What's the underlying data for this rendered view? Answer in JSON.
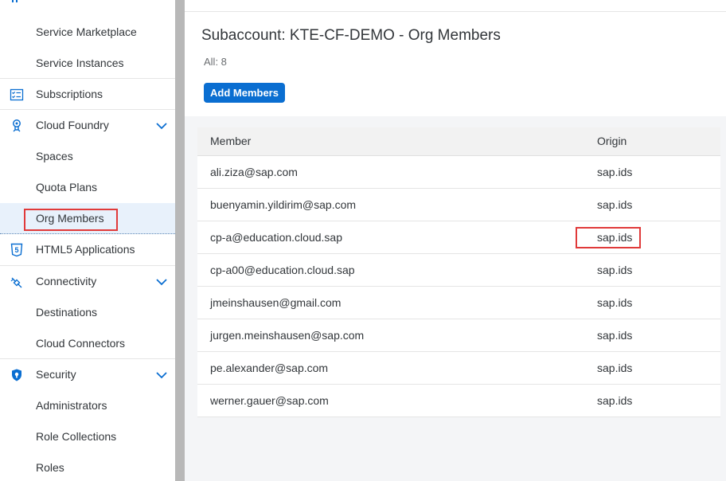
{
  "sidebar": {
    "items": [
      {
        "label": "Service Marketplace",
        "icon": null
      },
      {
        "label": "Service Instances",
        "icon": null
      },
      {
        "label": "Subscriptions",
        "icon": "checklist-icon"
      },
      {
        "label": "Cloud Foundry",
        "icon": "cloud-foundry-icon",
        "expanded": true
      },
      {
        "label": "Spaces",
        "icon": null
      },
      {
        "label": "Quota Plans",
        "icon": null
      },
      {
        "label": "Org Members",
        "icon": null,
        "selected": true
      },
      {
        "label": "HTML5 Applications",
        "icon": "html5-icon"
      },
      {
        "label": "Connectivity",
        "icon": "connectivity-icon",
        "expanded": true
      },
      {
        "label": "Destinations",
        "icon": null
      },
      {
        "label": "Cloud Connectors",
        "icon": null
      },
      {
        "label": "Security",
        "icon": "shield-icon",
        "expanded": true
      },
      {
        "label": "Administrators",
        "icon": null
      },
      {
        "label": "Role Collections",
        "icon": null
      },
      {
        "label": "Roles",
        "icon": null
      }
    ]
  },
  "main": {
    "title": "Subaccount: KTE-CF-DEMO - Org Members",
    "count_label": "All: 8",
    "add_button_label": "Add Members",
    "table": {
      "columns": [
        "Member",
        "Origin"
      ],
      "rows": [
        {
          "member": "ali.ziza@sap.com",
          "origin": "sap.ids"
        },
        {
          "member": "buenyamin.yildirim@sap.com",
          "origin": "sap.ids"
        },
        {
          "member": "cp-a@education.cloud.sap",
          "origin": "sap.ids"
        },
        {
          "member": "cp-a00@education.cloud.sap",
          "origin": "sap.ids"
        },
        {
          "member": "jmeinshausen@gmail.com",
          "origin": "sap.ids"
        },
        {
          "member": "jurgen.meinshausen@sap.com",
          "origin": "sap.ids"
        },
        {
          "member": "pe.alexander@sap.com",
          "origin": "sap.ids"
        },
        {
          "member": "werner.gauer@sap.com",
          "origin": "sap.ids"
        }
      ]
    }
  },
  "colors": {
    "accent": "#0a6ed1",
    "highlight_box": "#e03a3a",
    "selected_bg": "#e8f1fb"
  }
}
